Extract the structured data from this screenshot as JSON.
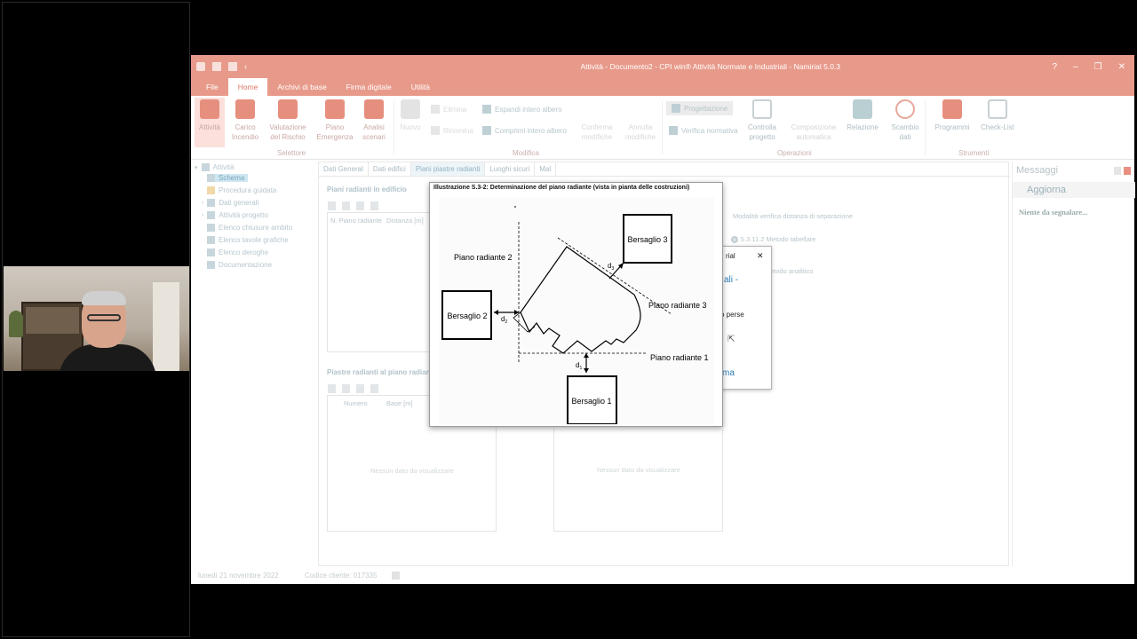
{
  "window": {
    "title": "Attività - Documento2 - CPI win® Attività  Normate e Industriali - Namirial 5.0.3",
    "help": "?",
    "minimize": "–",
    "restore": "❐",
    "close": "✕"
  },
  "tabs": [
    "File",
    "Home",
    "Archivi di base",
    "Firma digitale",
    "Utilità"
  ],
  "ribbon": {
    "attivita": "Attività",
    "carico": "Carico\nIncendio",
    "valutazione": "Valutazione\ndel Rischio",
    "piano": "Piano\nEmergenza",
    "analisi": "Analisi\nscenari",
    "selettore": "Selettore",
    "nuovo": "Nuovo",
    "elimina": "Elimina",
    "rinomina": "Rinomina",
    "espandi": "Espandi intero albero",
    "comprimi": "Comprimi intero albero",
    "conferma": "Conferma\nmodifiche",
    "annulla": "Annulla\nmodifiche",
    "modifica": "Modifica",
    "progettazione": "Progettazione",
    "verifica": "Verifica normativa",
    "controlla": "Controlla\nprogetto",
    "composizione": "Composizione\nautomatica",
    "relazione": "Relazione",
    "scambio": "Scambio\ndati",
    "operazioni": "Operazioni",
    "programmi": "Programmi",
    "checklist": "Check-List",
    "strumenti": "Strumenti"
  },
  "tree": {
    "root": "Attività",
    "items": [
      "Schema",
      "Procedura guidata",
      "Dati generali",
      "Attività progetto",
      "Elenco chiusure ambito",
      "Elenco tavole grafiche",
      "Elenco deroghe",
      "Documentazione"
    ]
  },
  "subtabs": [
    "Dati General",
    "Dati edifici",
    "Piani piastre radianti",
    "Luoghi sicuri",
    "Mal"
  ],
  "panels": {
    "piani_title": "Piani radianti in edificio",
    "col_n": "N. Piano radiante",
    "col_dist": "Distanza [m]",
    "piastre_title": "Piastre radianti al piano radiant",
    "col_numero": "Numero",
    "col_base": "Base [m]",
    "empty": "Nessun dato da visualizzare",
    "modalita": "Modalità verifica distanza di separazione",
    "metodo_tab": "S.3.11.2 Metodo tabellare",
    "metodo_an": "etodo analitico"
  },
  "dialog_behind": {
    "title_frag": "rial",
    "close": "✕",
    "line1": "ali -",
    "line2": "o perse",
    "link": "ma"
  },
  "illustration": {
    "title": "Illustrazione S.3-2: Determinazione del piano radiante (vista in pianta delle costruzioni)",
    "bersaglio1": "Bersaglio 1",
    "bersaglio2": "Bersaglio 2",
    "bersaglio3": "Bersaglio 3",
    "piano1": "Piano radiante 1",
    "piano2": "Piano radiante 2",
    "piano3": "Piano radiante 3"
  },
  "messages": {
    "title": "Messaggi",
    "refresh": "Aggiorna",
    "none": "Niente da segnalare..."
  },
  "status": {
    "date": "lunedì 21 novembre 2022",
    "client": "Codice cliente: 017335"
  }
}
